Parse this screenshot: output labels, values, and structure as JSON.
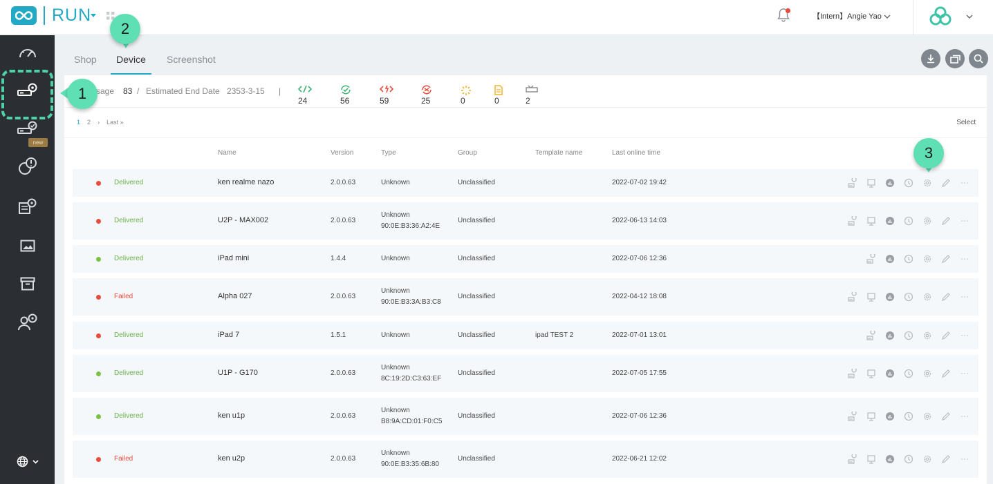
{
  "header": {
    "app_name": "RUN",
    "user": "【Intern】Angie Yao"
  },
  "tabs": [
    {
      "label": "Shop"
    },
    {
      "label": "Device"
    },
    {
      "label": "Screenshot"
    }
  ],
  "summary": {
    "usage_label": "sage",
    "usage_value": "83",
    "slash": "/",
    "end_label": "Estimated End Date",
    "end_value": "2353-3-15",
    "separator": "|",
    "stats": [
      {
        "icon": "code-icon",
        "color": "#3cb371",
        "value": "24"
      },
      {
        "icon": "sync-check-icon",
        "color": "#3cb371",
        "value": "56"
      },
      {
        "icon": "broken-code-icon",
        "color": "#e74c3c",
        "value": "59"
      },
      {
        "icon": "eye-off-icon",
        "color": "#e74c3c",
        "value": "25"
      },
      {
        "icon": "loading-icon",
        "color": "#f0b429",
        "value": "0"
      },
      {
        "icon": "document-icon",
        "color": "#f0b429",
        "value": "0"
      },
      {
        "icon": "device-offline-icon",
        "color": "#888888",
        "value": "2"
      }
    ]
  },
  "pagination": {
    "page1": "1",
    "page2": "2",
    "next": "›",
    "last": "Last »"
  },
  "select_label": "Select",
  "table": {
    "columns": [
      "Name",
      "Version",
      "Type",
      "Group",
      "Template name",
      "Last online time"
    ],
    "rows": [
      {
        "dot": "#e74c3c",
        "status": "Delivered",
        "status_color": "#6ab04c",
        "name": "ken realme nazo",
        "version": "2.0.0.63",
        "type": "Unknown",
        "mac": "",
        "group": "Unclassified",
        "template": "",
        "last_online": "2022-07-02 19:42",
        "full_actions": true
      },
      {
        "dot": "#e74c3c",
        "status": "Delivered",
        "status_color": "#6ab04c",
        "name": "U2P - MAX002",
        "version": "2.0.0.63",
        "type": "Unknown",
        "mac": "90:0E:B3:36:A2:4E",
        "group": "Unclassified",
        "template": "",
        "last_online": "2022-06-13 14:03",
        "full_actions": true
      },
      {
        "dot": "#7cc242",
        "status": "Delivered",
        "status_color": "#6ab04c",
        "name": "iPad mini",
        "version": "1.4.4",
        "type": "Unknown",
        "mac": "",
        "group": "Unclassified",
        "template": "",
        "last_online": "2022-07-06 12:36",
        "full_actions": false
      },
      {
        "dot": "#e74c3c",
        "status": "Failed",
        "status_color": "#e74c3c",
        "name": "Alpha 027",
        "version": "2.0.0.63",
        "type": "Unknown",
        "mac": "90:0E:B3:3A:B3:C8",
        "group": "Unclassified",
        "template": "",
        "last_online": "2022-04-12 18:08",
        "full_actions": true
      },
      {
        "dot": "#e74c3c",
        "status": "Delivered",
        "status_color": "#6ab04c",
        "name": "iPad 7",
        "version": "1.5.1",
        "type": "Unknown",
        "mac": "",
        "group": "Unclassified",
        "template": "ipad TEST 2",
        "last_online": "2022-07-01 13:01",
        "full_actions": false
      },
      {
        "dot": "#7cc242",
        "status": "Delivered",
        "status_color": "#6ab04c",
        "name": "U1P - G170",
        "version": "2.0.0.63",
        "type": "Unknown",
        "mac": "8C:19:2D:C3:63:EF",
        "group": "Unclassified",
        "template": "",
        "last_online": "2022-07-05 17:55",
        "full_actions": true
      },
      {
        "dot": "#7cc242",
        "status": "Delivered",
        "status_color": "#6ab04c",
        "name": "ken u1p",
        "version": "2.0.0.63",
        "type": "Unknown",
        "mac": "B8:9A:CD:01:F0:C5",
        "group": "Unclassified",
        "template": "",
        "last_online": "2022-07-06 12:36",
        "full_actions": true
      },
      {
        "dot": "#e74c3c",
        "status": "Failed",
        "status_color": "#e74c3c",
        "name": "ken u2p",
        "version": "2.0.0.63",
        "type": "Unknown",
        "mac": "90:0E:B3:35:6B:80",
        "group": "Unclassified",
        "template": "",
        "last_online": "2022-06-21 12:02",
        "full_actions": true
      }
    ]
  },
  "sidebar": {
    "new_badge": "new"
  },
  "callouts": {
    "one": "1",
    "two": "2",
    "three": "3"
  },
  "colors": {
    "accent": "#22a9c6",
    "callout": "#5fe0b4",
    "sidebar": "#2b2e33"
  }
}
